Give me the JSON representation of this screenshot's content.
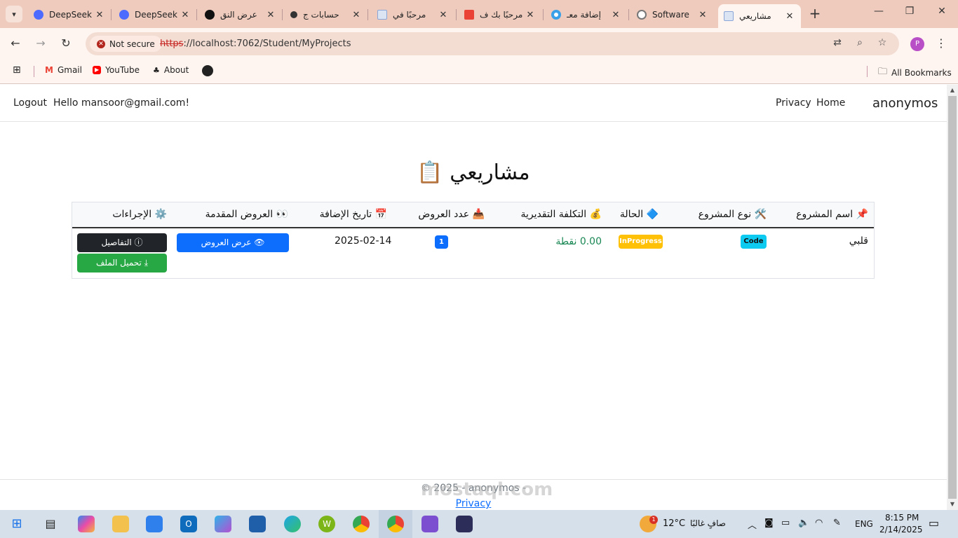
{
  "browser": {
    "tabs": [
      {
        "title": "DeepSeek",
        "icon": "deepseek-icon",
        "color": "#4d6bfe"
      },
      {
        "title": "DeepSeek",
        "icon": "deepseek-icon",
        "color": "#4d6bfe"
      },
      {
        "title": "عرض النق",
        "icon": "openai-icon",
        "color": "#111111"
      },
      {
        "title": "حسابات ج",
        "icon": "app-icon",
        "color": "#333333"
      },
      {
        "title": "مرحبًا في",
        "icon": "doc-icon",
        "color": "#8aa6d8"
      },
      {
        "title": "مرحبًا بك ف",
        "icon": "gmail-icon",
        "color": "#ea4335"
      },
      {
        "title": "إضافة معـ",
        "icon": "circle-icon",
        "color": "#3aa0e8"
      },
      {
        "title": "Software",
        "icon": "globe-icon",
        "color": "#777777"
      },
      {
        "title": "مشاريعي",
        "icon": "doc-icon",
        "color": "#8aa6d8",
        "active": true
      }
    ],
    "security_label": "Not secure",
    "url_scheme": "https",
    "url_rest": "://localhost:7062/Student/MyProjects",
    "profile_initial": "P",
    "bookmarks": [
      {
        "label": "Gmail",
        "icon": "gmail-icon"
      },
      {
        "label": "YouTube",
        "icon": "youtube-icon"
      },
      {
        "label": "About",
        "icon": "about-icon"
      },
      {
        "label": "",
        "icon": "github-icon"
      }
    ],
    "all_bookmarks": "All Bookmarks"
  },
  "site": {
    "brand": "anonymos",
    "nav_home": "Home",
    "nav_privacy": "Privacy",
    "greeting": "Hello mansoor@gmail.com!",
    "logout": "Logout",
    "page_title": "مشاريعي 📋",
    "table": {
      "headers": {
        "name": "📌 اسم المشروع",
        "type": "🛠️ نوع المشروع",
        "status": "🔷 الحالة",
        "cost": "💰 التكلفة التقديرية",
        "offers_count": "📥 عدد العروض",
        "date": "📅 تاريخ الإضافة",
        "offers": "👀 العروض المقدمة",
        "actions": "⚙️ الإجراءات"
      },
      "rows": [
        {
          "name": "قلبي",
          "type": "Code",
          "status": "InProgress",
          "cost": "0.00 نقطة",
          "offers_count": "1",
          "date": "2025-02-14",
          "view_offers": "عرض العروض",
          "details": "التفاصيل",
          "download": "تحميل الملف"
        }
      ]
    },
    "footer_copyright": "© 2025 - anonymos -",
    "footer_privacy": "Privacy"
  },
  "watermark": "mostaql.com",
  "taskbar": {
    "weather_temp": "12°C",
    "weather_text": "صافٍ غالبًا",
    "weather_badge": "1",
    "language": "ENG",
    "time": "8:15 PM",
    "date": "2/14/2025"
  },
  "colors": {
    "chrome_tabs": "#eecbbd",
    "chrome_toolbar": "#fff5f0",
    "badge_type": "#0dcaf0",
    "badge_status": "#ffc107",
    "badge_count": "#0d6efd",
    "btn_details": "#212529",
    "btn_offers": "#0d6efd",
    "btn_download": "#28a745",
    "cost_text": "#198754"
  }
}
